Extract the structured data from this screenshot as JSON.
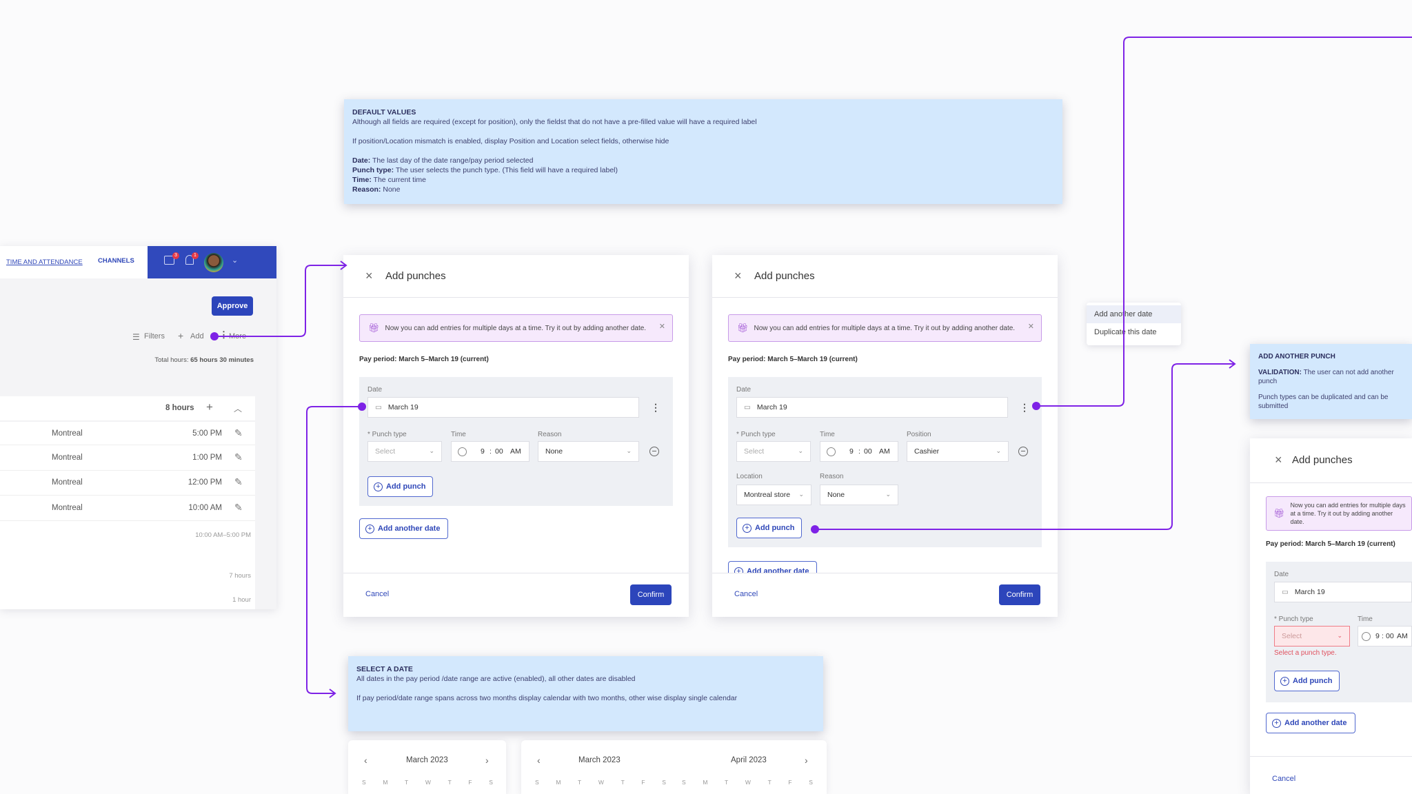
{
  "colors": {
    "accent": "#2c45bb",
    "connector": "#7e22e6",
    "note_bg": "#d3e8fd",
    "banner_bg": "#f6e9fc",
    "error": "#e0505e"
  },
  "app": {
    "nav": [
      {
        "label": "TIME AND ATTENDANCE",
        "active": true
      },
      {
        "label": "CHANNELS",
        "active": false
      }
    ],
    "messages_badge": "3",
    "notifications_badge": "1",
    "icons": [
      "chat-icon",
      "bell-icon",
      "avatar",
      "chevron-down-icon"
    ],
    "approve": "Approve",
    "toolbar": {
      "filters": "Filters",
      "add": "Add",
      "more": "More"
    },
    "total_label": "Total hours:",
    "total_value": "65 hours 30 minutes",
    "group_hours": "8 hours",
    "rows": [
      {
        "location": "Montreal",
        "time": "5:00 PM"
      },
      {
        "location": "Montreal",
        "time": "1:00 PM"
      },
      {
        "location": "Montreal",
        "time": "12:00 PM"
      },
      {
        "location": "Montreal",
        "time": "10:00 AM"
      }
    ],
    "range": "10:00 AM–5:00 PM",
    "hours_7": "7 hours",
    "hours_1": "1 hour"
  },
  "notes": {
    "default_values": {
      "title": "DEFAULT VALUES",
      "line1": "Although all fields are required (except for position), only the fieldst that do not have a pre-filled value will have a required label",
      "line2": "If position/Location mismatch is enabled, display Position and Location select fields, otherwise hide",
      "items": [
        {
          "k": "Date:",
          "v": " The last day of the date range/pay period selected"
        },
        {
          "k": "Punch type:",
          "v": " The user selects the punch type. (This field will have a required label)"
        },
        {
          "k": "Time:",
          "v": " The current time"
        },
        {
          "k": "Reason:",
          "v": " None"
        }
      ]
    },
    "select_date": {
      "title": "SELECT A DATE",
      "line1": "All dates in the pay period /date range are active (enabled), all other dates are disabled",
      "line2": "If pay period/date range spans across two months display calendar with two months, other wise display single calendar"
    },
    "add_punch": {
      "title": "ADD ANOTHER PUNCH",
      "validation_label": "VALIDATION:",
      "validation": " The user can not add another punch",
      "line2": "Punch types can be duplicated and can be submitted"
    }
  },
  "dialog": {
    "title": "Add punches",
    "banner": "Now you can add entries for multiple days at a time. Try it out by adding another date.",
    "pay_period": "Pay period: March 5–March 19 (current)",
    "date_label": "Date",
    "date_value": "March 19",
    "punch_type_label": "* Punch type",
    "punch_type_placeholder": "Select",
    "time_label": "Time",
    "time_h": "9",
    "time_sep": ":",
    "time_m": "00",
    "time_ampm": "AM",
    "reason_label": "Reason",
    "reason_value": "None",
    "position_label": "Position",
    "position_value": "Cashier",
    "location_label": "Location",
    "location_value": "Montreal store",
    "add_punch": "Add punch",
    "add_another_date": "Add another date",
    "cancel": "Cancel",
    "confirm": "Confirm",
    "error": "Select a punch type."
  },
  "menu": {
    "items": [
      "Add another date",
      "Duplicate this date"
    ]
  },
  "calendars": {
    "single": {
      "month": "March 2023"
    },
    "double": {
      "left": "March 2023",
      "right": "April 2023"
    },
    "weekdays": [
      "S",
      "M",
      "T",
      "W",
      "T",
      "F",
      "S"
    ]
  }
}
